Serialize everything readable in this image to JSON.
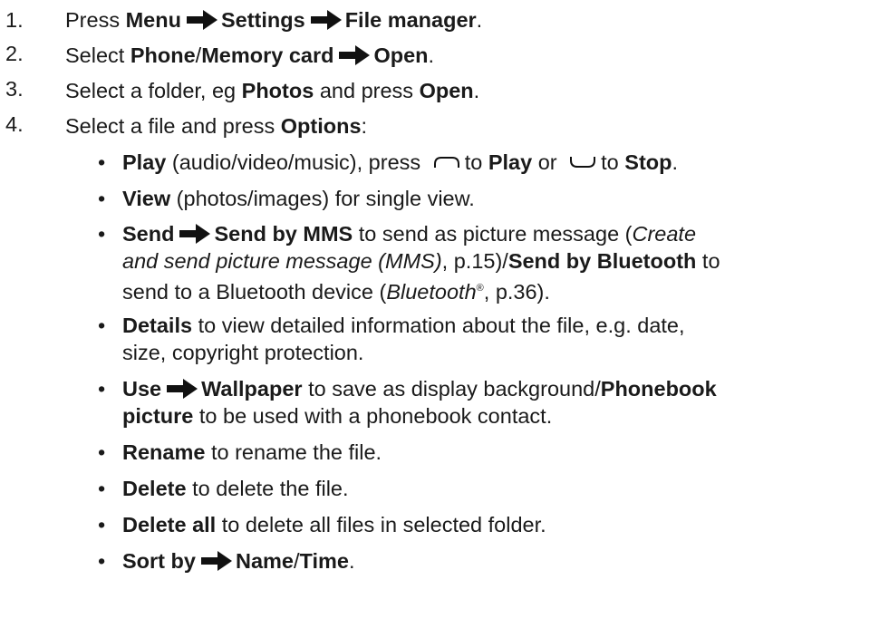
{
  "steps": [
    {
      "num": "1.",
      "a": "Press ",
      "b1": "Menu",
      "b2": "Settings",
      "b3": "File manager",
      "end": "."
    },
    {
      "num": "2.",
      "a": "Select ",
      "b1": "Phone",
      "sep": "/",
      "b2": "Memory card",
      "b3": "Open",
      "end": "."
    },
    {
      "num": "3.",
      "a": "Select a folder, eg ",
      "b1": "Photos",
      "mid": " and press ",
      "b2": "Open",
      "end": "."
    },
    {
      "num": "4.",
      "a": "Select a file and press ",
      "b1": "Options",
      "end": ":"
    }
  ],
  "bullet_glyph": "•",
  "options": {
    "play": {
      "b1": "Play",
      "t1": " (audio/video/music), press ",
      "t2": "to ",
      "b2": "Play",
      "t3": " or ",
      "t4": "to ",
      "b3": "Stop",
      "end": "."
    },
    "view": {
      "b1": "View",
      "t1": " (photos/images) for single view."
    },
    "send": {
      "b1": "Send",
      "b2": "Send by MMS",
      "t1": " to send as picture message (",
      "i1": "Create",
      "i2": "and send picture message (MMS)",
      "t2": ", p.15)/",
      "b3": "Send by Bluetooth",
      "t3": " to",
      "t4": "send to a Bluetooth device (",
      "i3": "Bluetooth",
      "sup": "®",
      "t5": ", p.36)."
    },
    "details": {
      "b1": "Details",
      "t1": " to view detailed information about the file, e.g. date,",
      "t2": "size, copyright protection."
    },
    "use": {
      "b1": "Use",
      "b2": "Wallpaper",
      "t1": " to save as display background/",
      "b3": "Phonebook",
      "b4": "picture",
      "t2": " to be used with a phonebook contact."
    },
    "rename": {
      "b1": "Rename",
      "t1": " to rename the file."
    },
    "delete": {
      "b1": "Delete",
      "t1": " to delete the file."
    },
    "delete_all": {
      "b1": "Delete all",
      "t1": " to delete all files in selected folder."
    },
    "sort": {
      "b1": "Sort by",
      "b2": "Name",
      "sep": "/",
      "b3": "Time",
      "end": "."
    }
  }
}
